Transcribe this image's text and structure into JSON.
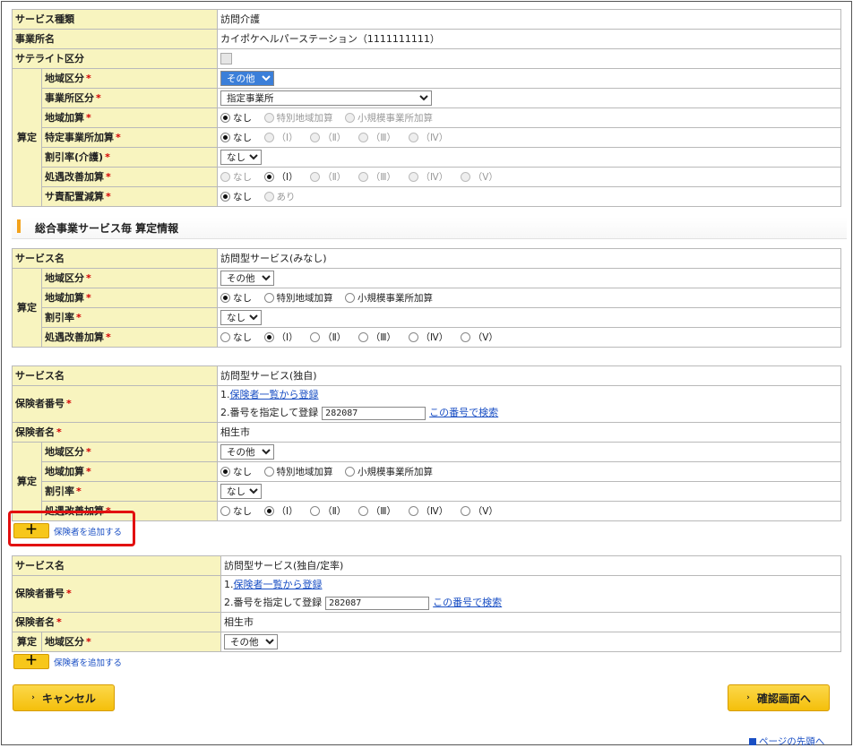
{
  "form1": {
    "service_type_label": "サービス種類",
    "service_type_value": "訪問介護",
    "office_label": "事業所名",
    "office_value": "カイポケヘルパーステーション（1111111111）",
    "satellite_label": "サテライト区分",
    "santei": "算定",
    "region_label": "地域区分",
    "region_value": "その他",
    "office_class_label": "事業所区分",
    "office_class_value": "指定事業所",
    "area_add_label": "地域加算",
    "area_opts": [
      "なし",
      "特別地域加算",
      "小規模事業所加算"
    ],
    "special_label": "特定事業所加算",
    "roman5": [
      "なし",
      "（Ⅰ）",
      "（Ⅱ）",
      "（Ⅲ）",
      "（Ⅳ）"
    ],
    "discount_label": "割引率(介護)",
    "discount_value": "なし",
    "treat_label": "処遇改善加算",
    "roman6": [
      "なし",
      "（Ⅰ）",
      "（Ⅱ）",
      "（Ⅲ）",
      "（Ⅳ）",
      "（Ⅴ）"
    ],
    "sasekihai_label": "サ責配置減算",
    "sasekihai_opts": [
      "なし",
      "あり"
    ],
    "req": "*"
  },
  "section_title": "総合事業サービス毎 算定情報",
  "svc1": {
    "name_label": "サービス名",
    "name_value": "訪問型サービス(みなし)",
    "region_value": "その他",
    "discount_label": "割引率",
    "discount_value": "なし"
  },
  "svc2": {
    "name_value": "訪問型サービス(独自)",
    "insurer_no_label": "保険者番号",
    "insurer_line1_prefix": "1.",
    "insurer_line1_link": "保険者一覧から登録",
    "insurer_line2_prefix": "2.番号を指定して登録",
    "insurer_no_value": "282087",
    "search_link": "この番号で検索",
    "insurer_name_label": "保険者名",
    "insurer_name_value": "相生市"
  },
  "svc3": {
    "name_value": "訪問型サービス(独自/定率)",
    "insurer_no_value": "282087",
    "insurer_name_value": "相生市",
    "region_value": "その他"
  },
  "add_insurer": "保険者を追加する",
  "plus": "＋",
  "cancel_label": "キャンセル",
  "confirm_label": "確認画面へ",
  "chev": "›",
  "page_top": "ページの先頭へ"
}
